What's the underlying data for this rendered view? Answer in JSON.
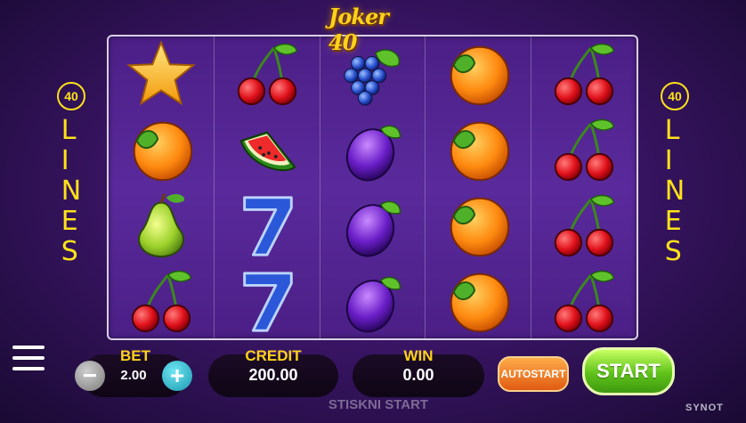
{
  "game": {
    "title": "Joker 40",
    "brand": "SYNOT"
  },
  "lines": {
    "count": "40",
    "label": "LINES"
  },
  "reels": [
    [
      "star",
      "orange",
      "pear",
      "cherry"
    ],
    [
      "cherry",
      "watermelon",
      "seven",
      "seven"
    ],
    [
      "grapes",
      "plum",
      "plum",
      "plum"
    ],
    [
      "orange",
      "orange",
      "orange",
      "orange"
    ],
    [
      "cherry",
      "cherry",
      "cherry",
      "cherry"
    ]
  ],
  "bet": {
    "label": "BET",
    "value": "2.00"
  },
  "credit": {
    "label": "CREDIT",
    "value": "200.00"
  },
  "win": {
    "label": "WIN",
    "value": "0.00"
  },
  "buttons": {
    "autostart": "AUTOSTART",
    "start": "START"
  },
  "hint": "STISKNI START"
}
